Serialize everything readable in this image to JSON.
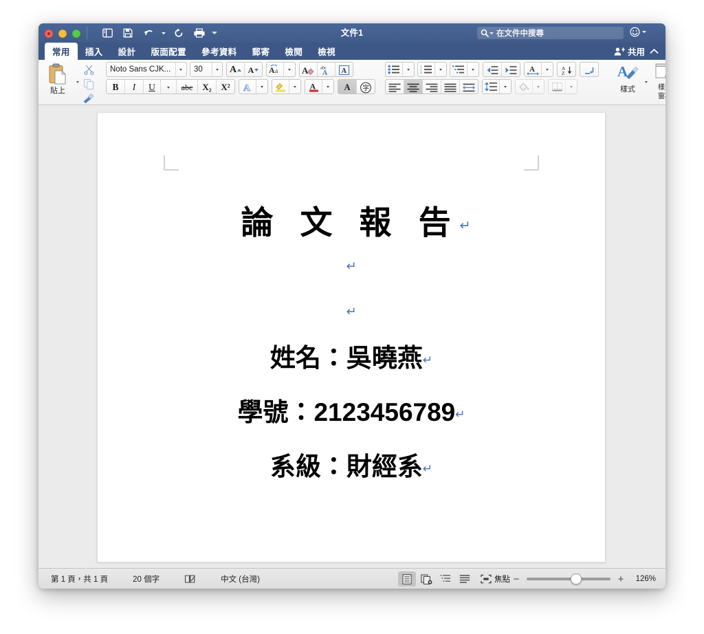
{
  "window": {
    "title": "文件1",
    "traffic_lights": [
      "close",
      "minimize",
      "zoom"
    ],
    "quick_access": [
      {
        "name": "sidebar-toggle",
        "icon": "sidebar-icon"
      },
      {
        "name": "save",
        "icon": "save-icon"
      },
      {
        "name": "undo",
        "icon": "undo-icon"
      },
      {
        "name": "redo",
        "icon": "redo-icon"
      },
      {
        "name": "print",
        "icon": "print-icon"
      },
      {
        "name": "customize-toolbar",
        "icon": "chevron-down-icon"
      }
    ],
    "search": {
      "placeholder": "在文件中搜尋",
      "icon": "search-icon"
    },
    "smiley_label": "☺",
    "accent_color": "#44618f",
    "tabbar_color": "#3d5886"
  },
  "tabs": {
    "items": [
      {
        "label": "常用",
        "active": true
      },
      {
        "label": "插入",
        "active": false
      },
      {
        "label": "設計",
        "active": false
      },
      {
        "label": "版面配置",
        "active": false
      },
      {
        "label": "參考資料",
        "active": false
      },
      {
        "label": "郵寄",
        "active": false
      },
      {
        "label": "檢閱",
        "active": false
      },
      {
        "label": "檢視",
        "active": false
      }
    ],
    "share_label": "共用",
    "collapse_icon": "chevron-up-icon"
  },
  "ribbon": {
    "clipboard": {
      "paste_label": "貼上",
      "cut_icon": "scissors-icon",
      "copy_icon": "copy-icon",
      "format_painter_icon": "paintbrush-icon"
    },
    "font": {
      "family_value": "Noto Sans CJK...",
      "size_value": "30",
      "grow_label": "A",
      "shrink_label": "A",
      "change_case_label": "Aa",
      "clear_formatting_icon": "clear-format-icon",
      "phonetic_guide_label": "abc",
      "character_border_label": "A",
      "bold_label": "B",
      "italic_label": "I",
      "underline_label": "U",
      "strikethrough_label": "abc",
      "subscript_label": "X₂",
      "superscript_label": "X²",
      "text_effects_label": "A",
      "highlight_label": "A",
      "font_color_label": "A",
      "shading_label": "A",
      "enclose_label": "字"
    },
    "paragraph": {
      "bullets_icon": "bullet-list-icon",
      "numbering_icon": "numbered-list-icon",
      "multilevel_icon": "multilevel-list-icon",
      "decrease_indent_icon": "decrease-indent-icon",
      "increase_indent_icon": "increase-indent-icon",
      "sort_icon": "sort-az-icon",
      "show_marks_icon": "pilcrow-icon",
      "align_left_icon": "align-left-icon",
      "align_center_icon": "align-center-icon",
      "align_right_icon": "align-right-icon",
      "align_justify_icon": "align-justify-icon",
      "distribute_icon": "distribute-icon",
      "line_spacing_icon": "line-spacing-icon",
      "shading_icon": "paint-bucket-icon",
      "borders_icon": "borders-icon",
      "align_center_active": true
    },
    "styles": {
      "styles_label": "樣式",
      "styles_pane_label": "樣式\n窗格",
      "styles_pane_line1": "樣式",
      "styles_pane_line2": "窗格"
    }
  },
  "document": {
    "title_text": "論 文 報 告",
    "pilcrow": "↵",
    "blank_lines": 2,
    "lines": [
      {
        "text": "姓名：吳曉燕"
      },
      {
        "text": "學號：2123456789"
      },
      {
        "text": "系級：財經系"
      }
    ]
  },
  "statusbar": {
    "page_info": "第 1 頁，共 1 頁",
    "word_count": "20 個字",
    "proofing_icon": "proofing-icon",
    "language": "中文 (台灣)",
    "view_buttons": [
      {
        "name": "print-layout-view",
        "icon": "page-layout-icon",
        "active": true
      },
      {
        "name": "web-layout-view",
        "icon": "web-layout-icon",
        "active": false
      },
      {
        "name": "outline-view",
        "icon": "outline-icon",
        "active": false
      },
      {
        "name": "draft-view",
        "icon": "draft-icon",
        "active": false
      }
    ],
    "focus_label": "焦點",
    "focus_icon": "focus-icon",
    "zoom_out": "−",
    "zoom_in": "+",
    "zoom_value": "126%"
  }
}
